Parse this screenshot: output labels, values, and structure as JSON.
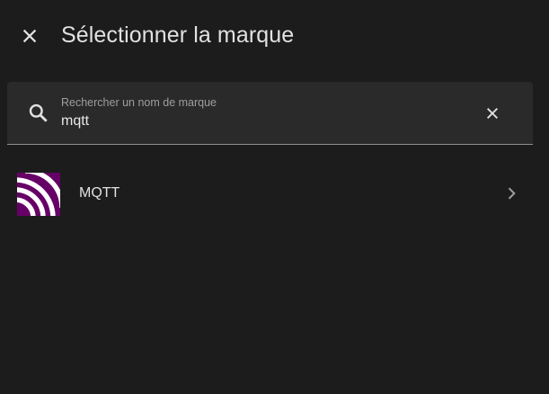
{
  "header": {
    "title": "Sélectionner la marque"
  },
  "search": {
    "label": "Rechercher un nom de marque",
    "value": "mqtt"
  },
  "brands": [
    {
      "name": "MQTT",
      "logo_color": "#660066"
    }
  ],
  "colors": {
    "background": "#1c1c1c",
    "field_background": "#2a2a2a",
    "text_primary": "#e1e1e1",
    "text_secondary": "#9e9e9e",
    "mqtt_brand": "#660066"
  },
  "icons": [
    "close-icon",
    "search-icon",
    "clear-icon",
    "chevron-right-icon"
  ]
}
